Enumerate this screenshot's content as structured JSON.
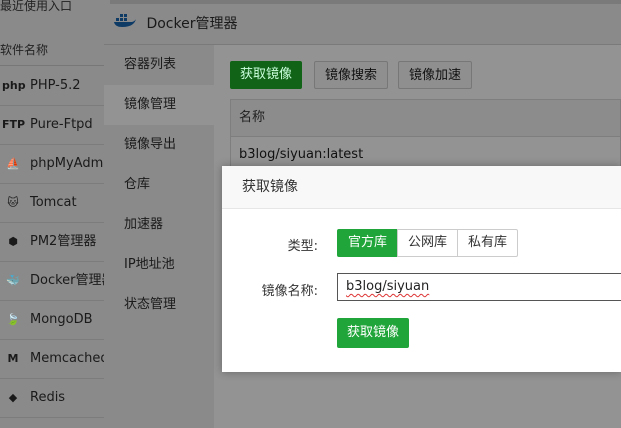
{
  "background": {
    "header": "最近使用入口",
    "column_header": "软件名称",
    "software": [
      {
        "icon": "php-icon",
        "glyph": "php",
        "label": "PHP-5.2"
      },
      {
        "icon": "ftp-icon",
        "glyph": "FTP",
        "label": "Pure-Ftpd"
      },
      {
        "icon": "phpmyadmin-icon",
        "glyph": "⛵",
        "label": "phpMyAdmin"
      },
      {
        "icon": "tomcat-icon",
        "glyph": "🐱",
        "label": "Tomcat"
      },
      {
        "icon": "nodejs-icon",
        "glyph": "⬢",
        "label": "PM2管理器"
      },
      {
        "icon": "docker-icon",
        "glyph": "🐳",
        "label": "Docker管理器"
      },
      {
        "icon": "mongodb-icon",
        "glyph": "🍃",
        "label": "MongoDB"
      },
      {
        "icon": "memcached-icon",
        "glyph": "M",
        "label": "Memcached"
      },
      {
        "icon": "redis-icon",
        "glyph": "◆",
        "label": "Redis"
      }
    ]
  },
  "docker_window": {
    "title": "Docker管理器",
    "nav": [
      "容器列表",
      "镜像管理",
      "镜像导出",
      "仓库",
      "加速器",
      "IP地址池",
      "状态管理"
    ],
    "active_nav": 1,
    "toolbar": {
      "get_image": "获取镜像",
      "search_image": "镜像搜索",
      "accelerate": "镜像加速"
    },
    "table": {
      "header": "名称",
      "rows": [
        "b3log/siyuan:latest"
      ]
    }
  },
  "modal": {
    "title": "获取镜像",
    "type_label": "类型:",
    "type_options": [
      "官方库",
      "公网库",
      "私有库"
    ],
    "selected_type": "官方库",
    "name_label": "镜像名称:",
    "name_value": "b3log/siyuan",
    "submit_label": "获取镜像"
  },
  "colors": {
    "accent_green": "#20a53a",
    "overlay": "#7a7a7a"
  }
}
